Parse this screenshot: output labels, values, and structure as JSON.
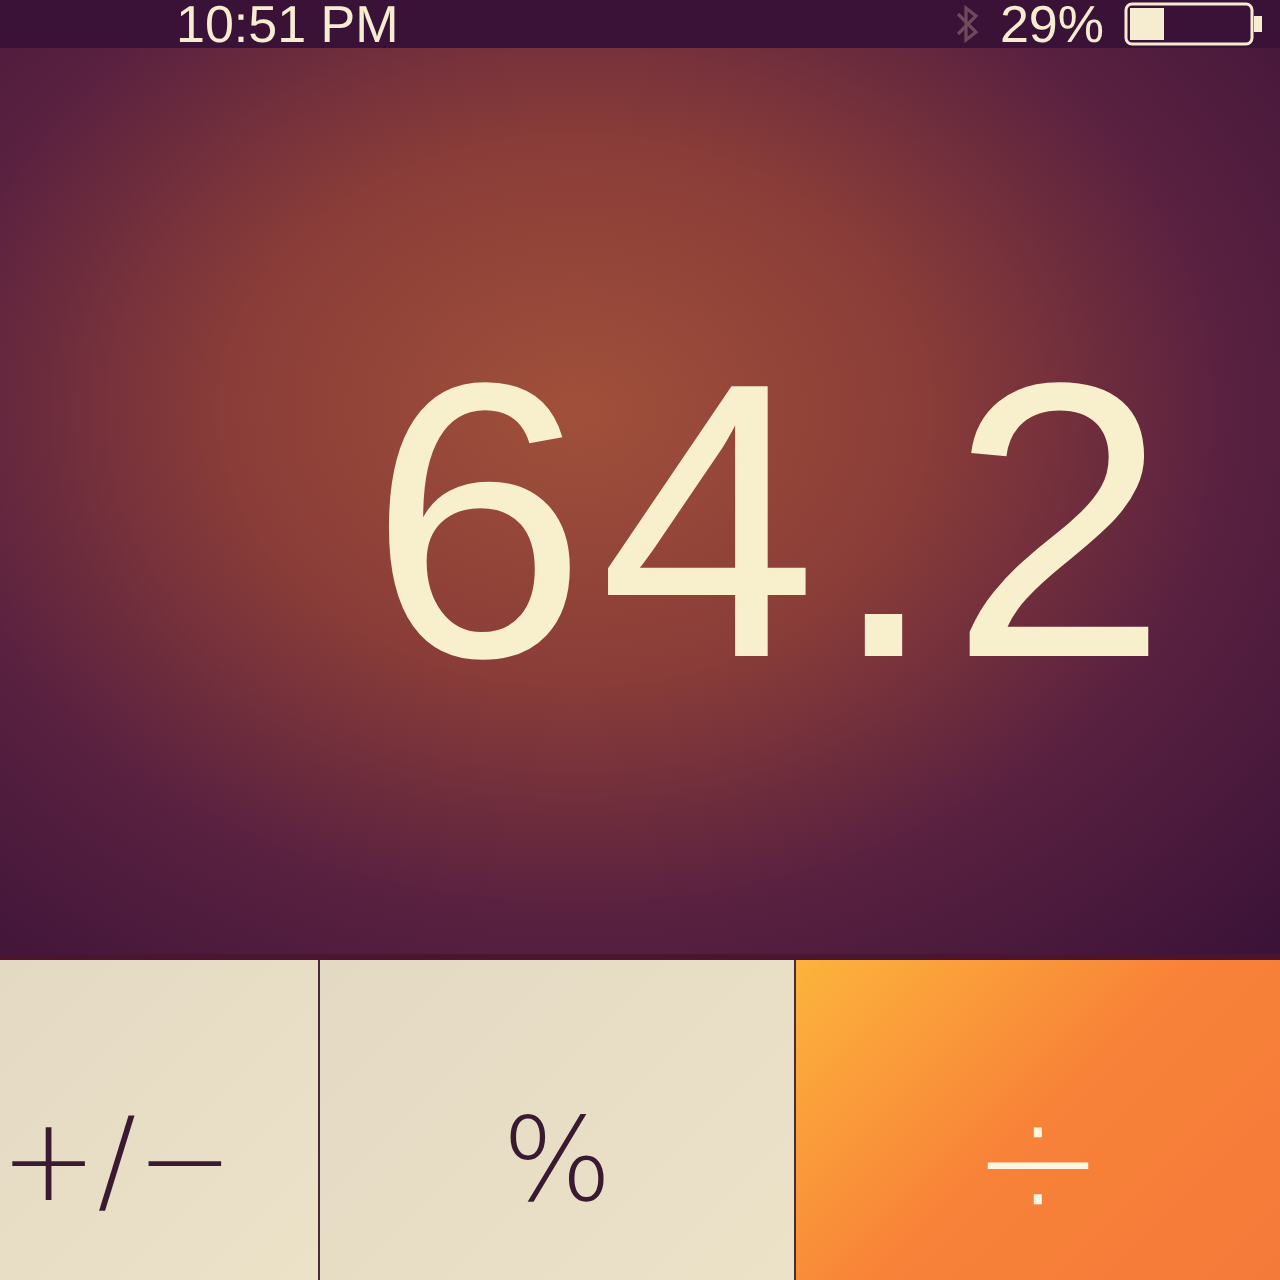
{
  "status_bar": {
    "time": "10:51 PM",
    "battery_text": "29%"
  },
  "display": {
    "value": "64.2"
  },
  "keys": [
    {
      "label": "+/−",
      "kind": "function"
    },
    {
      "label": "%",
      "kind": "function"
    },
    {
      "label": "÷",
      "kind": "operator"
    }
  ]
}
